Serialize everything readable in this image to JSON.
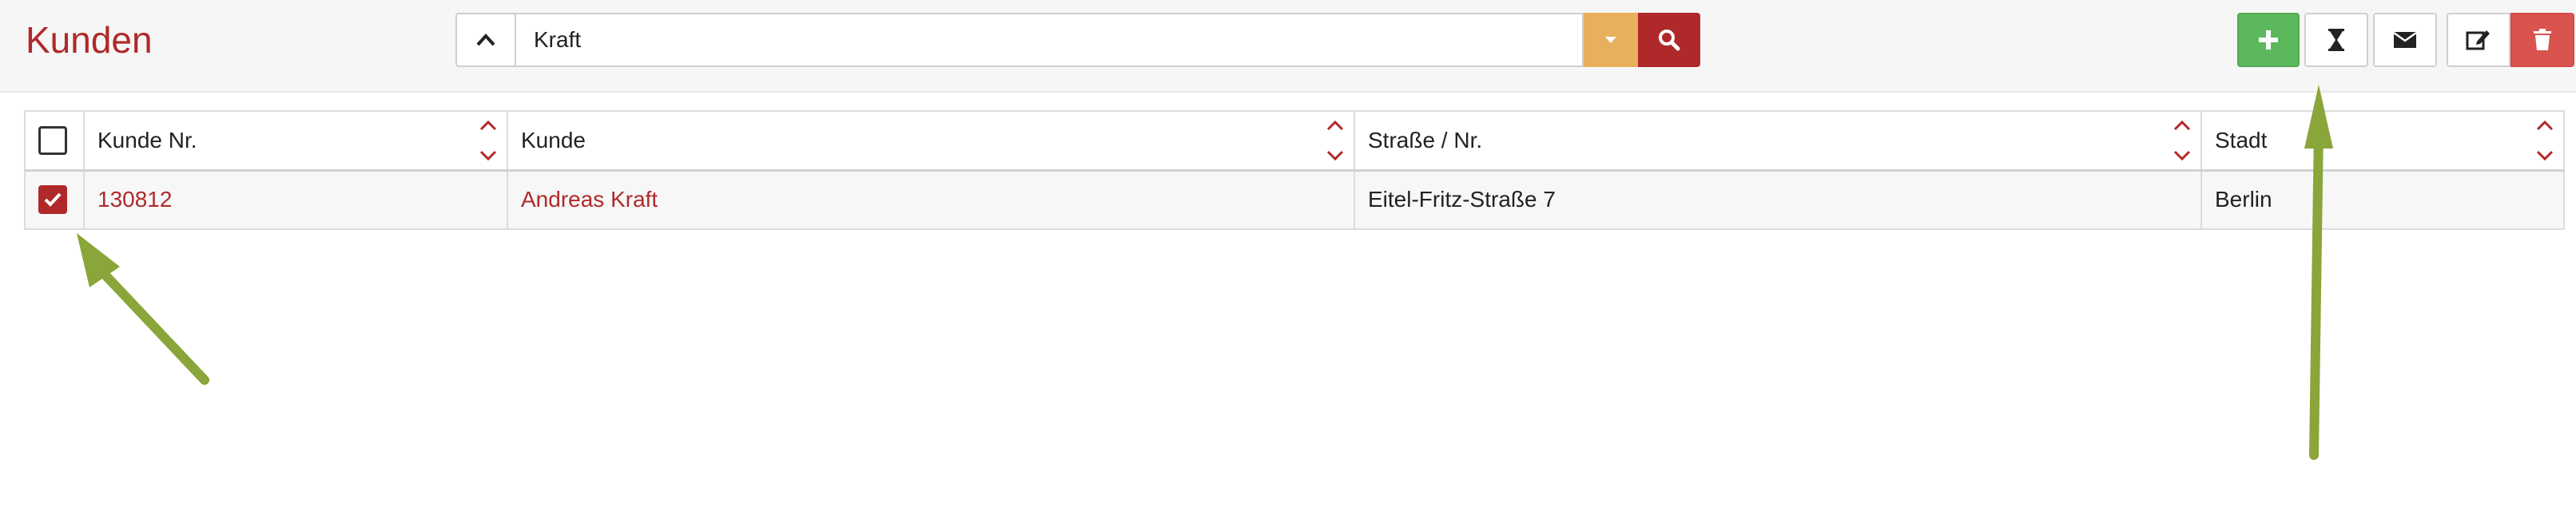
{
  "header": {
    "title": "Kunden",
    "search": {
      "value": "Kraft",
      "placeholder": ""
    }
  },
  "table": {
    "columns": [
      "Kunde Nr.",
      "Kunde",
      "Straße / Nr.",
      "Stadt"
    ],
    "rows": [
      {
        "checked": true,
        "nr": "130812",
        "kunde": "Andreas Kraft",
        "strasse": "Eitel-Fritz-Straße 7",
        "stadt": "Berlin"
      }
    ]
  },
  "toolbar": {
    "icons": [
      "plus-icon",
      "hourglass-icon",
      "envelope-icon",
      "edit-icon",
      "trash-icon"
    ]
  },
  "colors": {
    "accent": "#b0292a",
    "add": "#5cb85c",
    "delete": "#d9534f",
    "dropdown": "#e8b05c",
    "annotation_arrow": "#8aa53a"
  }
}
